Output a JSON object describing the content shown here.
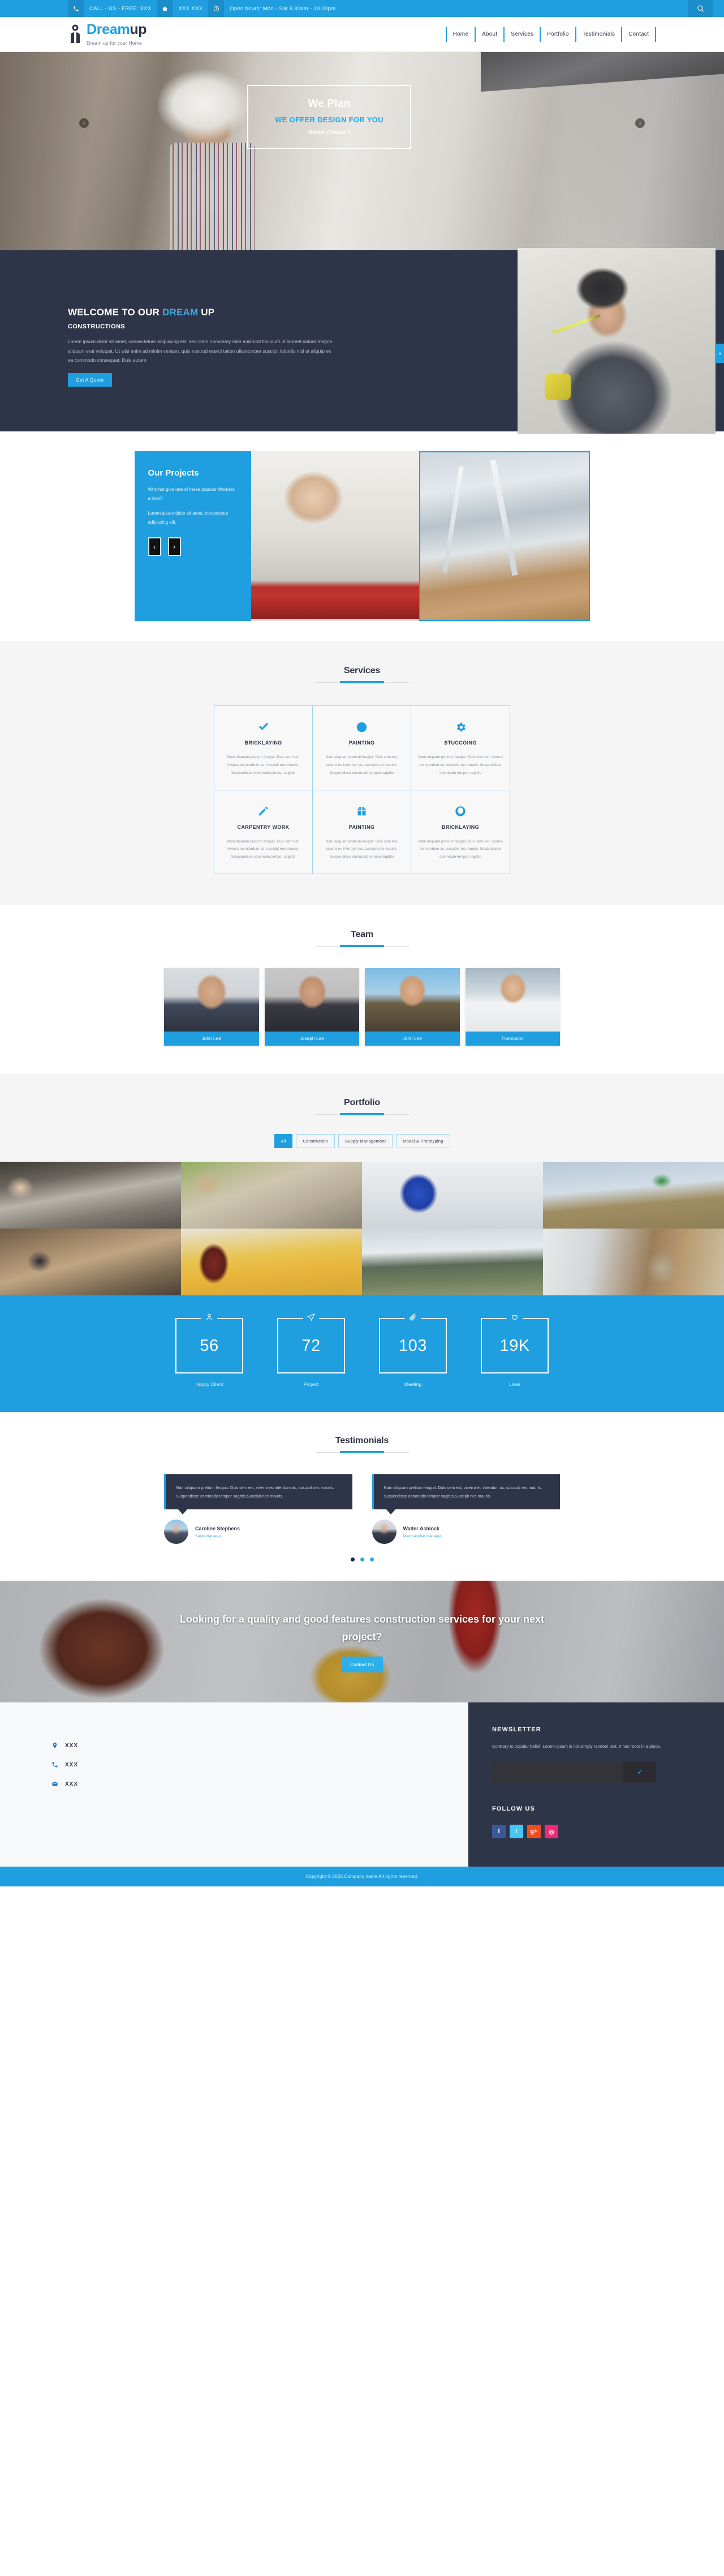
{
  "topbar": {
    "phone_icon": "phone-icon",
    "phone_text": "CALL - US - FREE:  XXX",
    "home_icon": "home-icon",
    "home_text": "XXX XXX",
    "clock_icon": "clock-icon",
    "hours_text": "Open hours: Mon - Sat 9.30am - 10.00pm",
    "search_icon": "search-icon"
  },
  "brand": {
    "mark": "worker-logo-icon",
    "name_1": "Dream",
    "name_2": "up",
    "tagline": "Dream up for your Home"
  },
  "nav": {
    "items": [
      {
        "label": "Home"
      },
      {
        "label": "About"
      },
      {
        "label": "Services"
      },
      {
        "label": "Portfolio"
      },
      {
        "label": "Testimonials"
      },
      {
        "label": "Contact"
      }
    ]
  },
  "hero": {
    "title": "We Plan",
    "subtitle": "WE OFFER DESIGN FOR YOU",
    "tagline": "Smart Choice !",
    "prev_icon": "chevron-left-icon",
    "next_icon": "chevron-right-icon"
  },
  "welcome": {
    "heading_pre": "WELCOME TO OUR ",
    "heading_accent": "DREAM",
    "heading_post": " UP",
    "subheading": "CONSTRUCTIONS",
    "paragraph": "Lorem ipsum dolor sit amet, consectetuer adipiscing elit, sed diam nonummy nibh euismod tincidunt ut laoreet dolore magna aliquam erat volutpat. Ut wisi enim ad minim veniam, quis nostrud exerci tation ullamcorper suscipit lobortis nisl ut aliquip ex ea commodo consequat. Duis autem",
    "button": "Get A Quote",
    "side_tab_icon": "chevron-down-icon"
  },
  "projects": {
    "title": "Our Projects",
    "line1": "Why not give one of these popular Workers a look?",
    "line2": "Lorem ipsum dolor sit amet, consectetur adipiscing elit.",
    "prev_icon": "chevron-left-icon",
    "next_icon": "chevron-right-icon"
  },
  "services": {
    "title": "Services",
    "desc": "Nam aliquam pretium feugiat. Duis sem est, viverra eu interdum ac, suscipit nec mauris. Suspendisse commodo tempor sagittis",
    "items": [
      {
        "icon": "check-icon",
        "name": "BRICKLAYING"
      },
      {
        "icon": "clock-icon",
        "name": "PAINTING"
      },
      {
        "icon": "gear-icon",
        "name": "STUCCOING"
      },
      {
        "icon": "pencil-icon",
        "name": "CARPENTRY WORK"
      },
      {
        "icon": "gift-icon",
        "name": "PAINTING"
      },
      {
        "icon": "eye-icon",
        "name": "BRICKLAYING"
      }
    ]
  },
  "team": {
    "title": "Team",
    "members": [
      {
        "name": "John Lee"
      },
      {
        "name": "Joseph Lee"
      },
      {
        "name": "John Lee"
      },
      {
        "name": "Thompson"
      }
    ]
  },
  "portfolio": {
    "title": "Portfolio",
    "filters": [
      {
        "label": "All",
        "active": true
      },
      {
        "label": "Construction",
        "active": false
      },
      {
        "label": "Supply Management",
        "active": false
      },
      {
        "label": "Model & Prototyping",
        "active": false
      }
    ]
  },
  "counters": {
    "items": [
      {
        "icon": "user-icon",
        "value": "56",
        "label": "Happy Client"
      },
      {
        "icon": "paper-plane-icon",
        "value": "72",
        "label": "Project"
      },
      {
        "icon": "paperclip-icon",
        "value": "103",
        "label": "Meeting"
      },
      {
        "icon": "heart-icon",
        "value": "19K",
        "label": "Likes"
      }
    ]
  },
  "testimonials": {
    "title": "Testimonials",
    "items": [
      {
        "text": "Nam aliquam pretium feugiat. Duis sem est, viverra eu interdum ac, suscipit nec mauris. Suspendisse commodo tempor sagittis,Suscipit nec mauris.",
        "name": "Caroline Stephens",
        "role": "Sales manager"
      },
      {
        "text": "Nam aliquam pretium feugiat. Duis sem est, viverra eu interdum ac, suscipit nec mauris. Suspendisse commodo tempor sagittis,Suscipit nec mauris.",
        "name": "Walter Ashlock",
        "role": "Merchandise manager"
      }
    ],
    "dots": 3,
    "active_dot": 0
  },
  "cta": {
    "headline": "Looking for a quality and good features construction services for your next project?",
    "button": "Contact Us"
  },
  "footer": {
    "contact": [
      {
        "icon": "map-pin-icon",
        "text": "XXX"
      },
      {
        "icon": "phone-icon",
        "text": "XXX"
      },
      {
        "icon": "envelope-icon",
        "text": "XXX"
      }
    ],
    "newsletter_title": "NEWSLETTER",
    "newsletter_text": "Contrary to popular belief, Lorem Ipsum is not simply random text. It has roots in a piece.",
    "newsletter_placeholder": "",
    "newsletter_submit_icon": "check-icon",
    "follow_title": "FOLLOW US",
    "social": [
      {
        "name": "facebook-icon",
        "glyph": "f",
        "color": "#3b5998"
      },
      {
        "name": "twitter-icon",
        "glyph": "t",
        "color": "#45c6f4"
      },
      {
        "name": "google-plus-icon",
        "glyph": "g+",
        "color": "#f04c24"
      },
      {
        "name": "dribbble-icon",
        "glyph": "◎",
        "color": "#ef2a75"
      }
    ],
    "copyright": "Copyright © 2020.Company name All rights reserved."
  },
  "colors": {
    "brand_blue": "#1f9fe0",
    "dark_navy": "#2f3549",
    "light_gray": "#f5f5f5"
  }
}
